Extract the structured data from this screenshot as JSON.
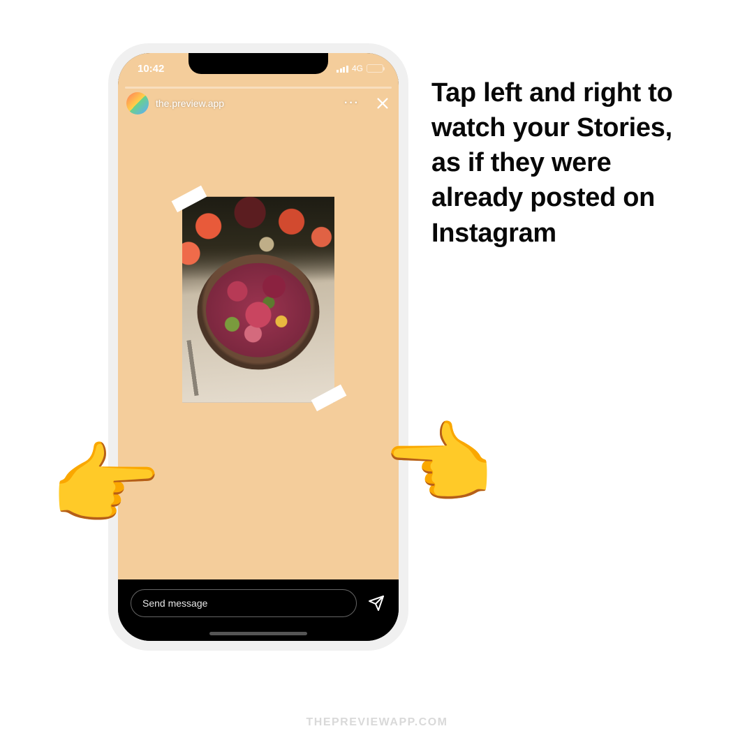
{
  "statusbar": {
    "time": "10:42",
    "network": "4G"
  },
  "story": {
    "username": "the.preview.app",
    "more_label": "···",
    "message_placeholder": "Send message"
  },
  "instruction": "Tap left and right to watch your Stories,\nas if they were already posted on Instagram",
  "hands": {
    "left": "👉",
    "right": "👉"
  },
  "watermark": "THEPREVIEWAPP.COM"
}
